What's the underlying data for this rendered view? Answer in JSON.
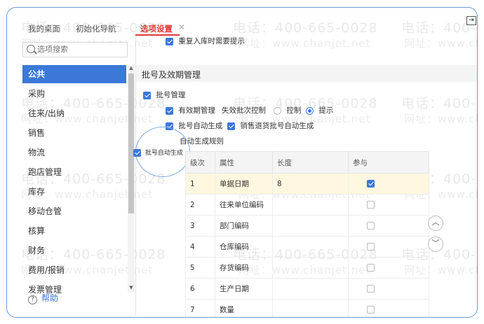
{
  "tabs": [
    {
      "label": "我的桌面"
    },
    {
      "label": "初始化导航"
    },
    {
      "label": "选项设置"
    }
  ],
  "search": {
    "placeholder": "选项搜索"
  },
  "sidebar": {
    "items": [
      "公共",
      "采购",
      "往来/出纳",
      "销售",
      "物流",
      "跑店管理",
      "库存",
      "移动仓管",
      "核算",
      "财务",
      "费用/报销",
      "发票管理"
    ],
    "active": "公共"
  },
  "help": {
    "label": "帮助"
  },
  "top_option": {
    "label": "重复入库时需要提示",
    "checked": true
  },
  "section": {
    "title": "批号及效期管理"
  },
  "batch_mgmt": {
    "label": "批号管理",
    "checked": true
  },
  "expiry_mgmt": {
    "label": "有效期管理",
    "checked": true
  },
  "invalid_batch": {
    "label": "失效批次控制"
  },
  "radio_control": {
    "label": "控制",
    "selected": false
  },
  "radio_prompt": {
    "label": "提示",
    "selected": true
  },
  "auto_gen": {
    "label": "批号自动生成",
    "checked": true
  },
  "sales_return": {
    "label": "销售退货批号自动生成",
    "checked": true
  },
  "rule_title": {
    "label": "自动生成规则"
  },
  "zoom_label": {
    "label": "批号自动生成",
    "checked": true
  },
  "table": {
    "headers": [
      "级次",
      "属性",
      "长度",
      "参与"
    ],
    "rows": [
      {
        "level": "1",
        "attr": "单据日期",
        "length": "8",
        "participate": true
      },
      {
        "level": "2",
        "attr": "往来单位编码",
        "length": "",
        "participate": false
      },
      {
        "level": "3",
        "attr": "部门编码",
        "length": "",
        "participate": false
      },
      {
        "level": "4",
        "attr": "仓库编码",
        "length": "",
        "participate": false
      },
      {
        "level": "5",
        "attr": "存货编码",
        "length": "",
        "participate": false
      },
      {
        "level": "6",
        "attr": "生产日期",
        "length": "",
        "participate": false
      },
      {
        "level": "7",
        "attr": "数量",
        "length": "",
        "participate": false
      }
    ]
  },
  "watermark": {
    "phone": "电话：400-665-0028",
    "site": "网址：www.chanjet.net"
  },
  "icons": [
    "search-icon",
    "help-icon",
    "expand-icon",
    "chevron-up-icon",
    "chevron-down-icon"
  ],
  "colors": {
    "accent": "#3b78d8",
    "active_tab": "#e03a3a",
    "highlight_row": "#fff7df"
  }
}
